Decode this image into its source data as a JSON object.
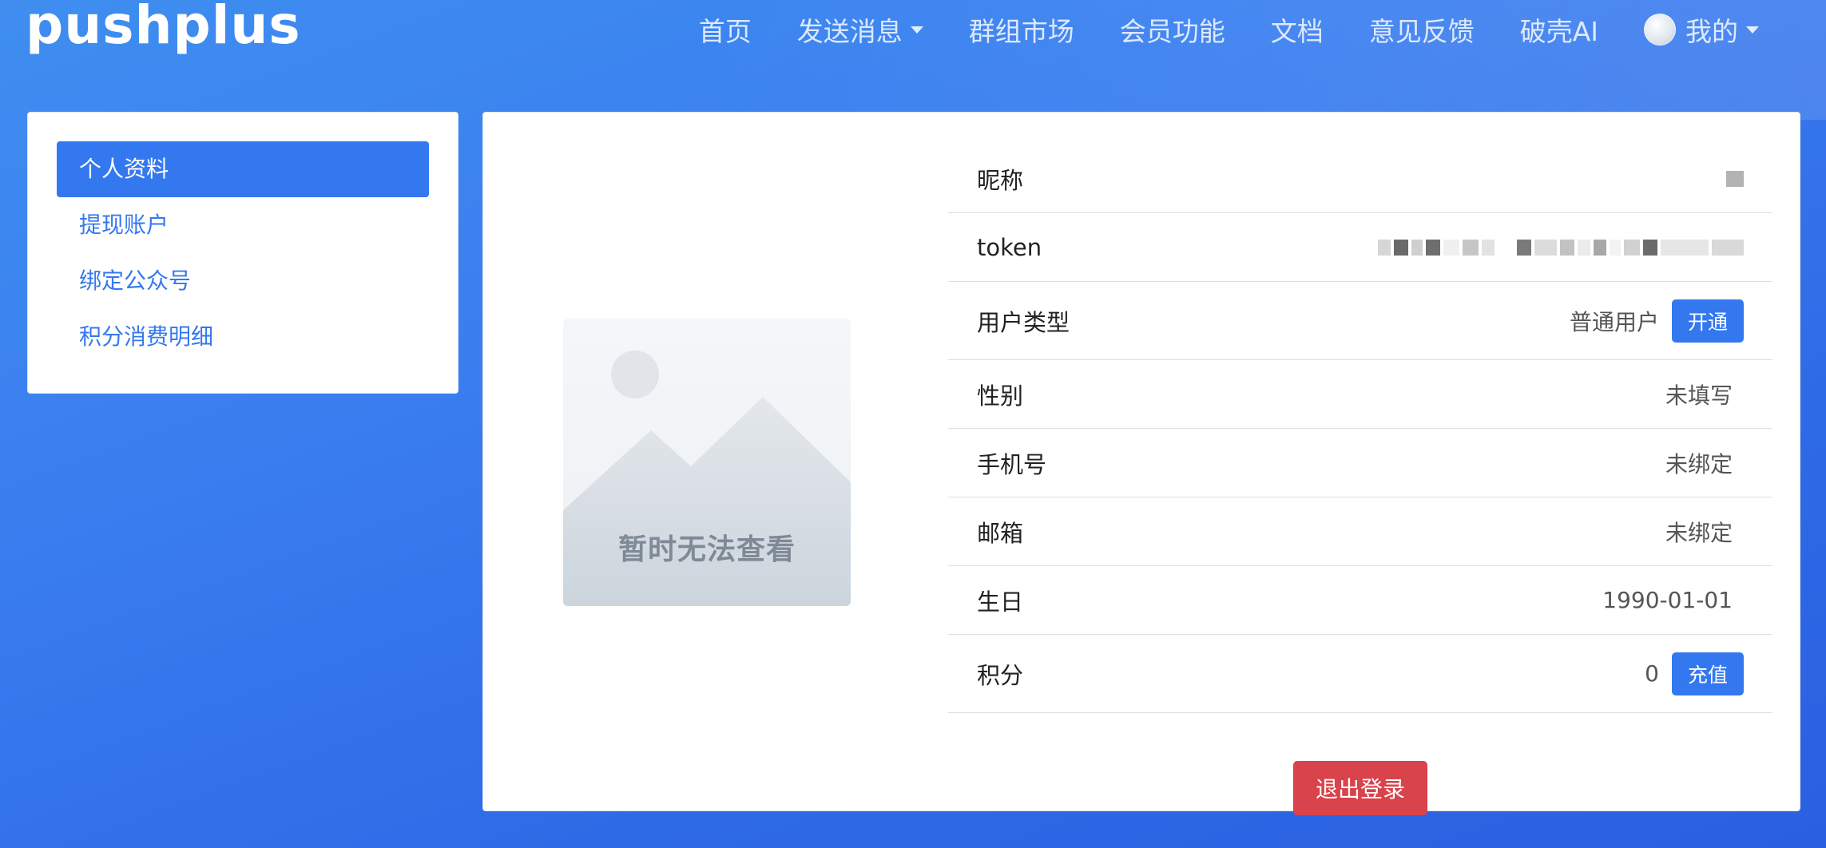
{
  "brand": {
    "logo_text": "pushplus"
  },
  "nav": {
    "items": [
      {
        "label": "首页"
      },
      {
        "label": "发送消息"
      },
      {
        "label": "群组市场"
      },
      {
        "label": "会员功能"
      },
      {
        "label": "文档"
      },
      {
        "label": "意见反馈"
      },
      {
        "label": "破壳AI"
      }
    ],
    "user_label": "我的"
  },
  "sidebar": {
    "items": [
      {
        "label": "个人资料",
        "active": true
      },
      {
        "label": "提现账户"
      },
      {
        "label": "绑定公众号"
      },
      {
        "label": "积分消费明细"
      }
    ]
  },
  "profile": {
    "avatar_placeholder": "暂时无法查看",
    "nickname": {
      "label": "昵称",
      "value": ""
    },
    "token": {
      "label": "token",
      "value": ""
    },
    "user_type": {
      "label": "用户类型",
      "value": "普通用户",
      "action": "开通"
    },
    "gender": {
      "label": "性别",
      "value": "未填写"
    },
    "phone": {
      "label": "手机号",
      "value": "未绑定"
    },
    "email": {
      "label": "邮箱",
      "value": "未绑定"
    },
    "birthday": {
      "label": "生日",
      "value": "1990-01-01"
    },
    "points": {
      "label": "积分",
      "value": "0",
      "action": "充值"
    },
    "logout_label": "退出登录"
  },
  "colors": {
    "primary": "#3478f0",
    "danger": "#d9434b",
    "background_start": "#3f8ef0",
    "background_end": "#2a60e0"
  }
}
